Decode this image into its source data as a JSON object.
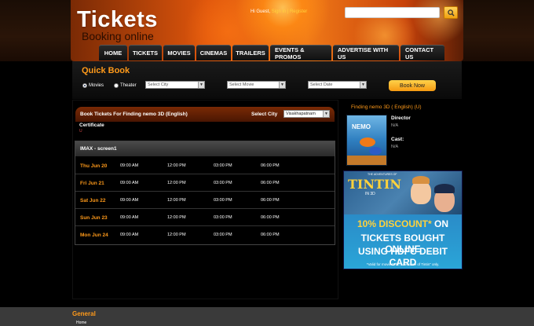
{
  "brand": {
    "title": "Tickets",
    "subtitle": "Booking online"
  },
  "user": {
    "greeting": "Hi Guest,",
    "sign_in": "Sign in",
    "separator": "|",
    "register": "Register"
  },
  "search": {
    "value": "",
    "placeholder": ""
  },
  "nav": [
    "HOME",
    "TICKETS",
    "MOVIES",
    "CINEMAS",
    "TRAILERS",
    "EVENTS & PROMOS",
    "ADVERTISE WITH US",
    "CONTACT US"
  ],
  "quick_book": {
    "title": "Quick Book",
    "radio_movies": "Movies",
    "radio_theater": "Theater",
    "select_city": "Select City",
    "select_movie": "Select Movie",
    "select_date": "Select Date",
    "book_now": "Book Now"
  },
  "booking": {
    "title": "Book Tickets For Finding nemo 3D (English)",
    "city_label": "Select City",
    "city_value": "Visakhapatnam",
    "certificate_label": "Certificate",
    "certificate_value": "U"
  },
  "screen": {
    "name": "IMAX - screen1",
    "shows": [
      {
        "date": "Thu Jun 20",
        "times": [
          "09:00 AM",
          "12:00 PM",
          "03:00 PM",
          "06:00 PM"
        ]
      },
      {
        "date": "Fri Jun 21",
        "times": [
          "09:00 AM",
          "12:00 PM",
          "03:00 PM",
          "06:00 PM"
        ]
      },
      {
        "date": "Sat Jun 22",
        "times": [
          "09:00 AM",
          "12:00 PM",
          "03:00 PM",
          "06:00 PM"
        ]
      },
      {
        "date": "Sun Jun 23",
        "times": [
          "09:00 AM",
          "12:00 PM",
          "03:00 PM",
          "06:00 PM"
        ]
      },
      {
        "date": "Mon Jun 24",
        "times": [
          "09:00 AM",
          "12:00 PM",
          "03:00 PM",
          "06:00 PM"
        ]
      }
    ]
  },
  "movie_info": {
    "title": "Finding nemo 3D ( English) (U)",
    "poster_text": "NEMO",
    "director_label": "Director",
    "director_value": "N/A",
    "cast_label": "Cast:",
    "cast_value": "N/A"
  },
  "promo": {
    "poster_sub": "THE ADVENTURES OF",
    "poster_title": "TINTIN",
    "poster_3d": "IN 3D",
    "line1_highlight": "10% DISCOUNT*",
    "line1_rest": " ON",
    "line2": "TICKETS BOUGHT ONLINE",
    "line3": "USING HDFC DEBIT CARD",
    "note": "*Valid for movie \"The Adventure of Tintin\" only."
  },
  "footer": {
    "title": "General",
    "home": "Home"
  },
  "colors": {
    "accent": "#ff9a1a",
    "header_orange": "#e0560c",
    "booking_bar": "#7a2a05"
  }
}
